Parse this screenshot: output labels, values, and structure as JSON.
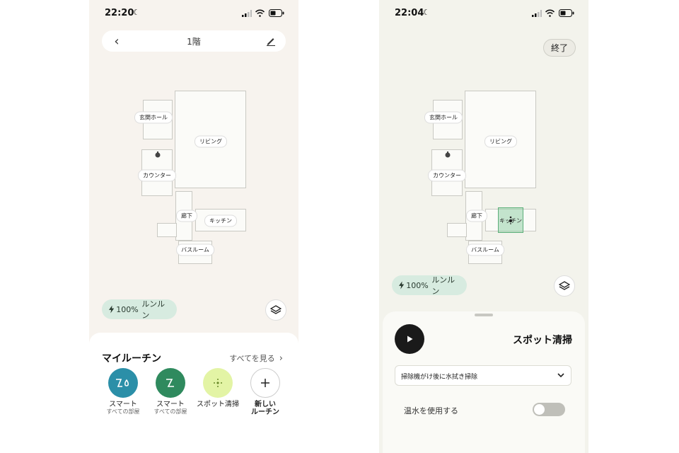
{
  "left_screen": {
    "status": {
      "time": "22:20"
    },
    "header": {
      "title": "1階"
    },
    "rooms": {
      "genkan": "玄関ホール",
      "living": "リビング",
      "counter": "カウンター",
      "hallway": "廊下",
      "kitchen": "キッチン",
      "bathroom": "バスルーム"
    },
    "battery": {
      "percent": "100%",
      "robot_name": "ルンルン"
    },
    "routines": {
      "title": "マイルーチン",
      "see_all": "すべてを見る",
      "items": [
        {
          "label": "スマート",
          "sub": "すべての部屋",
          "color": "#2b8fa8",
          "icon": "vacuum-mop-icon"
        },
        {
          "label": "スマート",
          "sub": "すべての部屋",
          "color": "#2f8a5e",
          "icon": "vacuum-icon"
        },
        {
          "label": "スポット清掃",
          "sub": "",
          "color": "#e3f4a5",
          "icon": "spot-icon"
        },
        {
          "label": "新しい",
          "sub": "ルーチン",
          "color": "#ffffff",
          "icon": "plus-icon"
        }
      ]
    }
  },
  "right_screen": {
    "status": {
      "time": "22:04"
    },
    "finish_label": "終了",
    "rooms": {
      "genkan": "玄関ホール",
      "living": "リビング",
      "counter": "カウンター",
      "hallway": "廊下",
      "kitchen": "キッチン",
      "bathroom": "バスルーム"
    },
    "battery": {
      "percent": "100%",
      "robot_name": "ルンルン"
    },
    "spot_sheet": {
      "title": "スポット清掃",
      "mode": "掃除機がけ後に水拭き掃除",
      "hot_water_label": "温水を使用する",
      "hot_water_on": false
    }
  },
  "colors": {
    "accent_green": "#5cae79",
    "battery_chip": "#d7ebe0"
  }
}
